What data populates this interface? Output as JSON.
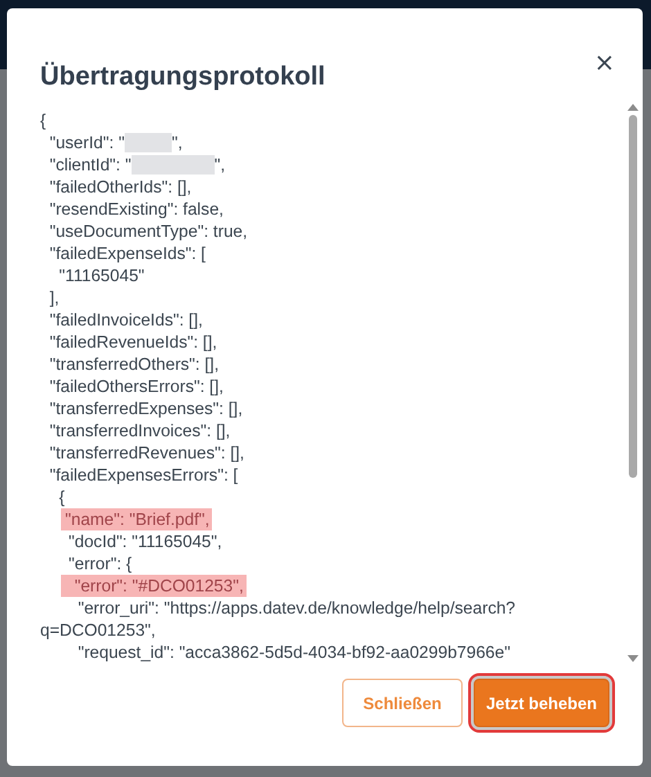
{
  "dialog": {
    "title": "Übertragungsprotokoll",
    "close": "×",
    "log_lines": [
      {
        "text": "{",
        "redacted": false,
        "highlighted": false
      },
      {
        "text": "  \"userId\": \"",
        "redacted": true,
        "after": "\",",
        "highlighted": false
      },
      {
        "text": "  \"clientId\": \"",
        "redacted": true,
        "after": "\",",
        "highlighted": false
      },
      {
        "text": "  \"failedOtherIds\": [],",
        "redacted": false,
        "highlighted": false
      },
      {
        "text": "  \"resendExisting\": false,",
        "redacted": false,
        "highlighted": false
      },
      {
        "text": "  \"useDocumentType\": true,",
        "redacted": false,
        "highlighted": false
      },
      {
        "text": "  \"failedExpenseIds\": [",
        "redacted": false,
        "highlighted": false
      },
      {
        "text": "    \"11165045\"",
        "redacted": false,
        "highlighted": false
      },
      {
        "text": "  ],",
        "redacted": false,
        "highlighted": false
      },
      {
        "text": "  \"failedInvoiceIds\": [],",
        "redacted": false,
        "highlighted": false
      },
      {
        "text": "  \"failedRevenueIds\": [],",
        "redacted": false,
        "highlighted": false
      },
      {
        "text": "  \"transferredOthers\": [],",
        "redacted": false,
        "highlighted": false
      },
      {
        "text": "  \"failedOthersErrors\": [],",
        "redacted": false,
        "highlighted": false
      },
      {
        "text": "  \"transferredExpenses\": [],",
        "redacted": false,
        "highlighted": false
      },
      {
        "text": "  \"transferredInvoices\": [],",
        "redacted": false,
        "highlighted": false
      },
      {
        "text": "  \"transferredRevenues\": [],",
        "redacted": false,
        "highlighted": false
      },
      {
        "text": "  \"failedExpensesErrors\": [",
        "redacted": false,
        "highlighted": false
      },
      {
        "text": "    {",
        "redacted": false,
        "highlighted": false
      },
      {
        "text": "\"name\": \"Brief.pdf\",",
        "redacted": false,
        "highlighted": true
      },
      {
        "text": "      \"docId\": \"11165045\",",
        "redacted": false,
        "highlighted": false
      },
      {
        "text": "      \"error\": {",
        "redacted": false,
        "highlighted": false
      },
      {
        "text": "  \"error\": \"#DCO01253\",",
        "redacted": false,
        "highlighted": true
      },
      {
        "text": "        \"error_uri\": \"https://apps.datev.de/knowledge/help/search?",
        "redacted": false,
        "highlighted": false
      },
      {
        "text": "q=DCO01253\",",
        "redacted": false,
        "highlighted": false
      },
      {
        "text": "        \"request_id\": \"acca3862-5d5d-4034-bf92-aa0299b7966e\"",
        "redacted": false,
        "highlighted": false
      }
    ],
    "buttons": [
      {
        "label": "Schließen",
        "kind": "secondary",
        "focused": false
      },
      {
        "label": "Jetzt beheben",
        "kind": "primary",
        "focused": true
      }
    ]
  }
}
